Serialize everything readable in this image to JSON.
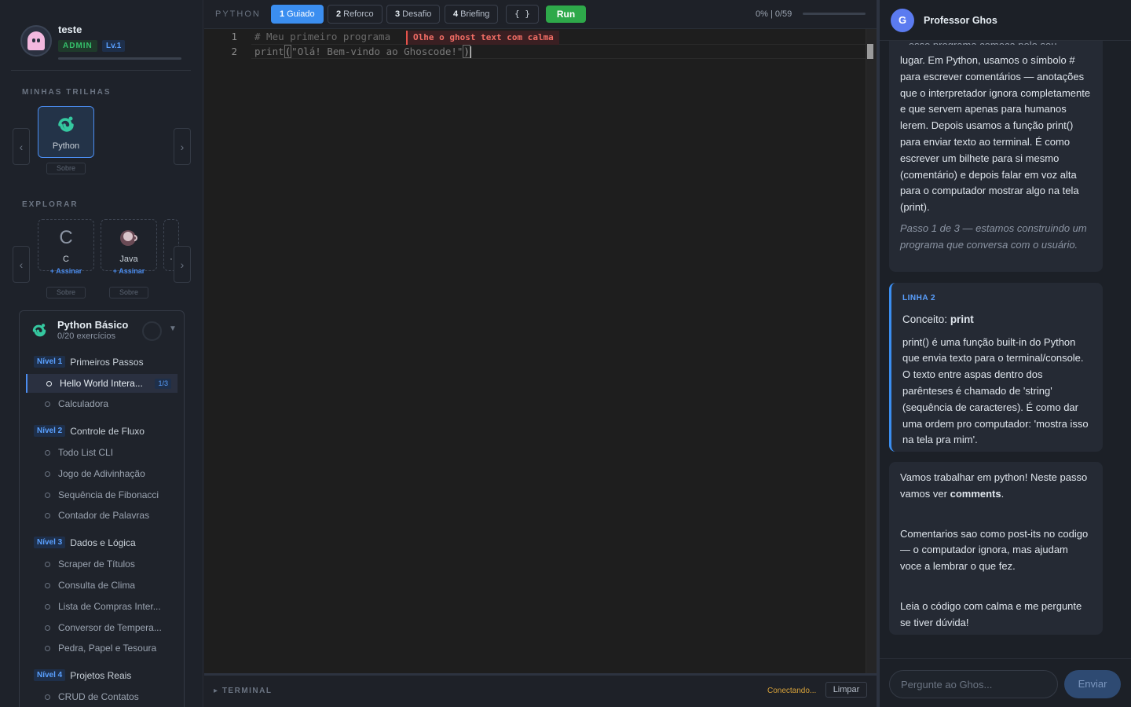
{
  "user": {
    "name": "teste",
    "role": "ADMIN",
    "level": "Lv.1"
  },
  "sidebar": {
    "my_tracks_title": "MINHAS TRILHAS",
    "explore_title": "EXPLORAR",
    "my_tracks": [
      {
        "name": "Python",
        "about": "Sobre"
      }
    ],
    "explore": [
      {
        "name": "C",
        "action": "+ Assinar",
        "about": "Sobre"
      },
      {
        "name": "Java",
        "action": "+ Assinar",
        "about": "Sobre"
      },
      {
        "name": "·"
      }
    ],
    "course": {
      "title": "Python Básico",
      "progress": "0/20 exercícios",
      "levels": [
        {
          "tag": "Nível 1",
          "name": "Primeiros Passos",
          "items": [
            {
              "label": "Hello World Intera...",
              "count": "1/3"
            },
            {
              "label": "Calculadora"
            }
          ]
        },
        {
          "tag": "Nível 2",
          "name": "Controle de Fluxo",
          "items": [
            {
              "label": "Todo List CLI"
            },
            {
              "label": "Jogo de Adivinhação"
            },
            {
              "label": "Sequência de Fibonacci"
            },
            {
              "label": "Contador de Palavras"
            }
          ]
        },
        {
          "tag": "Nível 3",
          "name": "Dados e Lógica",
          "items": [
            {
              "label": "Scraper de Títulos"
            },
            {
              "label": "Consulta de Clima"
            },
            {
              "label": "Lista de Compras Inter..."
            },
            {
              "label": "Conversor de Tempera..."
            },
            {
              "label": "Pedra, Papel e Tesoura"
            }
          ]
        },
        {
          "tag": "Nível 4",
          "name": "Projetos Reais",
          "items": [
            {
              "label": "CRUD de Contatos"
            }
          ]
        }
      ]
    }
  },
  "toolbar": {
    "language": "PYTHON",
    "modes": [
      {
        "num": "1",
        "label": "Guiado"
      },
      {
        "num": "2",
        "label": "Reforco"
      },
      {
        "num": "3",
        "label": "Desafio"
      },
      {
        "num": "4",
        "label": "Briefing"
      }
    ],
    "format_label": "{ }",
    "run_label": "Run",
    "progress_text": "0% | 0/59",
    "progress_value": 0
  },
  "editor": {
    "line_numbers": [
      "1",
      "2"
    ],
    "line1": "# Meu primeiro programa",
    "line2_fn": "print",
    "line2_open": "(",
    "line2_str": "\"Olá! Bem-vindo ao Ghoscode!\"",
    "line2_close": ")",
    "ghost_hint": "Olhe o ghost text com calma"
  },
  "terminal": {
    "label": "TERMINAL",
    "status": "Conectando...",
    "clear_label": "Limpar"
  },
  "chat": {
    "assistant_initial": "G",
    "assistant_name": "Professor Ghos",
    "msg1": {
      "clipped": "...esse programa começa pelo seu primeiro",
      "body": "lugar. Em Python, usamos o símbolo # para escrever comentários — anotações que o interpretador ignora completamente e que servem apenas para humanos lerem. Depois usamos a função print() para enviar texto ao terminal. É como escrever um bilhete para si mesmo (comentário) e depois falar em voz alta para o computador mostrar algo na tela (print).",
      "note": "Passo 1 de 3 — estamos construindo um programa que conversa com o usuário."
    },
    "msg2": {
      "tag": "LINHA 2",
      "concept_label": "Conceito:",
      "concept_name": "print",
      "body": "print() é uma função built-in do Python que envia texto para o terminal/console. O texto entre aspas dentro dos parênteses é chamado de 'string' (sequência de caracteres). É como dar uma ordem pro computador: 'mostra isso na tela pra mim'."
    },
    "msg3": {
      "p1_text": "Vamos trabalhar em python! Neste passo vamos ver",
      "p1_bold": "comments",
      "p1_end": ".",
      "p2": "Comentarios sao como post-its no codigo — o computador ignora, mas ajudam voce a lembrar o que fez.",
      "p3": "Leia o código com calma e me pergunte se tiver dúvida!"
    },
    "input_placeholder": "Pergunte ao Ghos...",
    "send_label": "Enviar"
  }
}
